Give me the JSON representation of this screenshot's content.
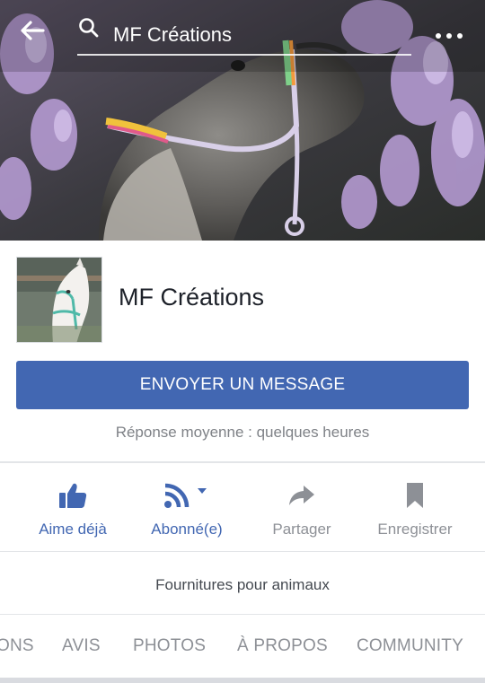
{
  "header": {
    "search_text": "MF Créations"
  },
  "profile": {
    "page_name": "MF Créations"
  },
  "message_button": {
    "label": "ENVOYER UN MESSAGE"
  },
  "response_time": "Réponse moyenne : quelques heures",
  "actions": [
    {
      "label": "Aime déjà",
      "icon": "thumbs-up-icon"
    },
    {
      "label": "Abonné(e)",
      "icon": "rss-icon"
    },
    {
      "label": "Partager",
      "icon": "share-arrow-icon"
    },
    {
      "label": "Enregistrer",
      "icon": "bookmark-icon"
    }
  ],
  "category": "Fournitures pour animaux",
  "tabs": [
    "ONS",
    "AVIS",
    "PHOTOS",
    "À PROPOS",
    "COMMUNITY"
  ],
  "colors": {
    "brand_blue": "#4267b2",
    "muted_text": "#8d9096",
    "divider": "#e3e5e8"
  }
}
